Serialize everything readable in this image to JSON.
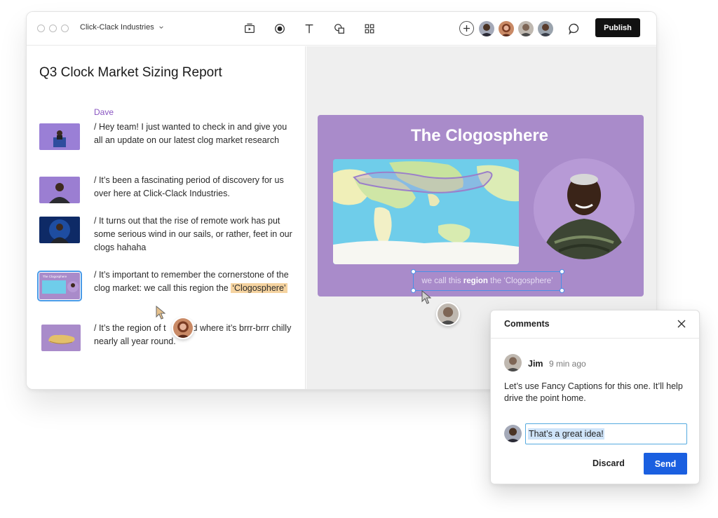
{
  "window": {
    "workspace_name": "Click-Clack Industries",
    "publish_label": "Publish"
  },
  "toolbar_icons": [
    "record-slide-icon",
    "record-icon",
    "text-icon",
    "shapes-icon",
    "grid-icon",
    "add-icon",
    "chat-icon"
  ],
  "document": {
    "title": "Q3 Clock Market Sizing Report",
    "speaker": "Dave",
    "paragraphs": [
      "/ Hey team! I just wanted to check in and give you all an update on our latest clog market research",
      "/ It’s been a fascinating period of discovery for us over here at Click-Clack Industries.",
      "/ It turns out that the rise of remote work has put some serious wind in our sails, or rather, feet in our clogs hahaha"
    ],
    "paragraph4": {
      "before": "/ It’s important to remember the cornerstone of the clog market: we call this region the",
      "highlight": "‘Clogosphere’"
    },
    "paragraph5": {
      "before": "/ It’s the region of t",
      "after": "rld where it’s brrr-brrr chilly nearly all year round."
    },
    "selected_thumb_title": "The Clogosphere"
  },
  "slide": {
    "title": "The Clogosphere",
    "caption_before": "we call this",
    "caption_bold": "region",
    "caption_after": "the ‘Clogosphere’"
  },
  "comments": {
    "header": "Comments",
    "author": "Jim",
    "time": "9 min ago",
    "body": "Let’s use Fancy Captions for this one. It’ll help drive the point home.",
    "reply_value": "That’s a great idea!",
    "discard_label": "Discard",
    "send_label": "Send"
  },
  "colors": {
    "accent": "#1a5fe0",
    "slide_bg": "#a98bca",
    "speaker": "#8a56c2",
    "highlight": "#f5d3a0"
  }
}
